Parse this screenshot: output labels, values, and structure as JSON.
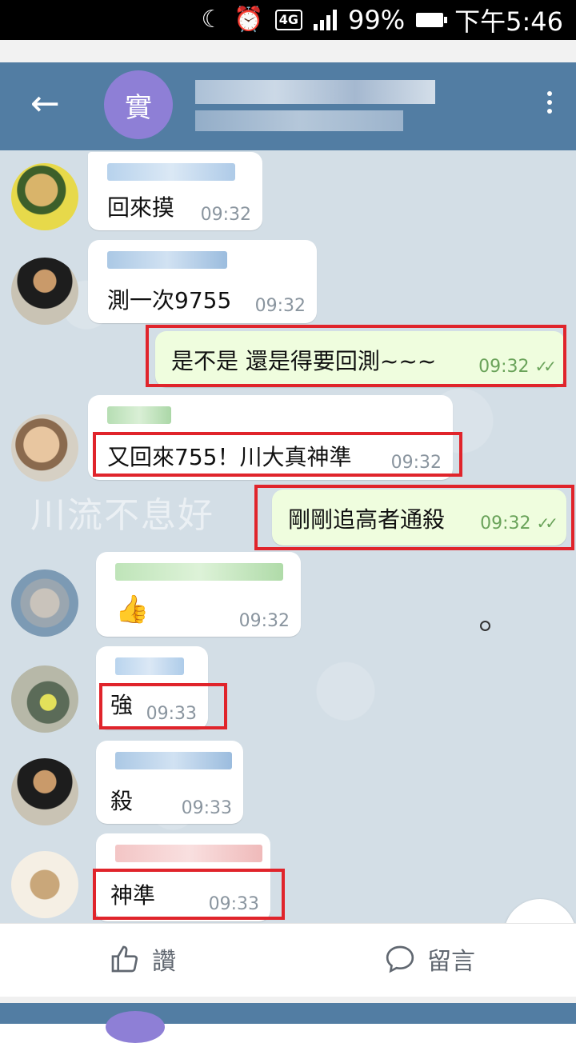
{
  "status_bar": {
    "network": "4G",
    "battery": "99%",
    "time": "下午5:46",
    "icons": [
      "moon-icon",
      "alarm-icon",
      "signal-icon",
      "battery-icon"
    ]
  },
  "header": {
    "back_icon": "back-arrow-icon",
    "avatar_letter": "實",
    "menu_icon": "more-vert-icon"
  },
  "watermark": "川流不息好",
  "messages": [
    {
      "text": "回來摸",
      "time": "09:32"
    },
    {
      "text": "測一次9755",
      "time": "09:32"
    },
    {
      "text": "是不是  還是得要回測~~~",
      "time": "09:32"
    },
    {
      "text": "又回來755！川大真神準",
      "time": "09:32"
    },
    {
      "text": "剛剛追高者通殺",
      "time": "09:32"
    },
    {
      "text": "👍",
      "time": "09:32"
    },
    {
      "text": "強",
      "time": "09:33"
    },
    {
      "text": "殺",
      "time": "09:33"
    },
    {
      "text": "神準",
      "time": "09:33"
    }
  ],
  "footer": {
    "like_label": "讚",
    "comment_label": "留言"
  },
  "colors": {
    "header": "#527da3",
    "outgoing_bubble": "#effdde",
    "highlight": "#e0242b",
    "avatar": "#8e7fd6"
  }
}
